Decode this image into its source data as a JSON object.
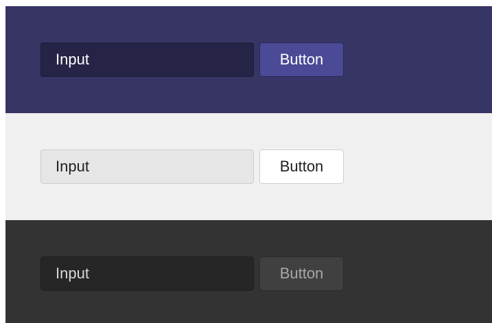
{
  "panels": [
    {
      "theme": "purple",
      "background": "#363564",
      "input": {
        "placeholder": "Input",
        "value": ""
      },
      "button": {
        "label": "Button",
        "color": "#4b4a96"
      }
    },
    {
      "theme": "light",
      "background": "#f0f0f0",
      "input": {
        "placeholder": "Input",
        "value": ""
      },
      "button": {
        "label": "Button",
        "color": "#ffffff"
      }
    },
    {
      "theme": "dark",
      "background": "#333333",
      "input": {
        "placeholder": "Input",
        "value": ""
      },
      "button": {
        "label": "Button",
        "color": "#404040"
      }
    }
  ]
}
